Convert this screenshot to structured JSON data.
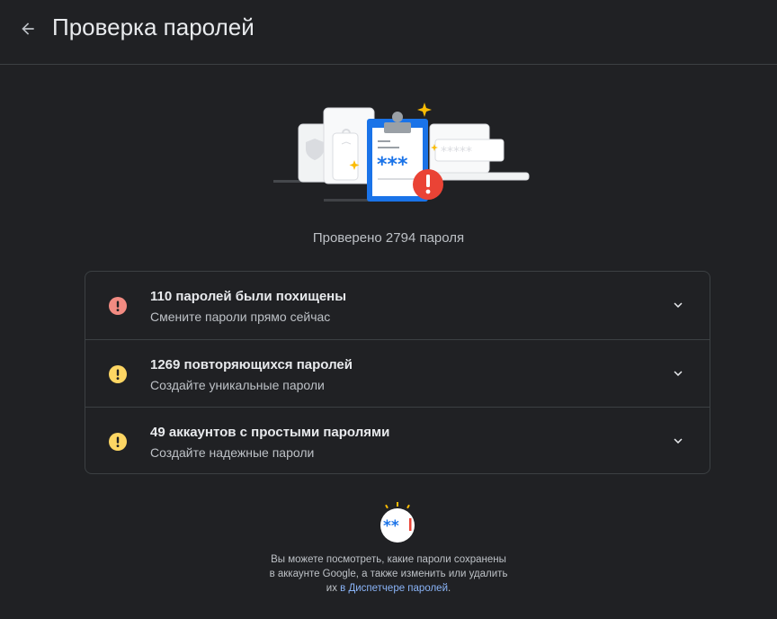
{
  "header": {
    "title": "Проверка паролей"
  },
  "summary": {
    "checked_text": "Проверено 2794 пароля"
  },
  "issues": [
    {
      "title": "110 паролей были похищены",
      "subtitle": "Смените пароли прямо сейчас",
      "severity": "danger",
      "color": "#f28b82"
    },
    {
      "title": "1269 повторяющихся паролей",
      "subtitle": "Создайте уникальные пароли",
      "severity": "warning",
      "color": "#fdd663"
    },
    {
      "title": "49 аккаунтов с простыми паролями",
      "subtitle": "Создайте надежные пароли",
      "severity": "warning",
      "color": "#fdd663"
    }
  ],
  "footer": {
    "line1": "Вы можете посмотреть, какие пароли сохранены",
    "line2": "в аккаунте Google, а также изменить или удалить",
    "line3_prefix": "их ",
    "link_text": "в Диспетчере паролей",
    "line3_suffix": "."
  },
  "icons": {
    "back": "arrow-left-icon",
    "danger": "error-circle-icon",
    "warning": "warning-circle-icon",
    "chevron": "chevron-down-icon"
  },
  "colors": {
    "background": "#202124",
    "accent_blue": "#1a73e8",
    "link": "#8ab4f8",
    "danger_badge": "#ea4335",
    "spark": "#fbbc04"
  }
}
